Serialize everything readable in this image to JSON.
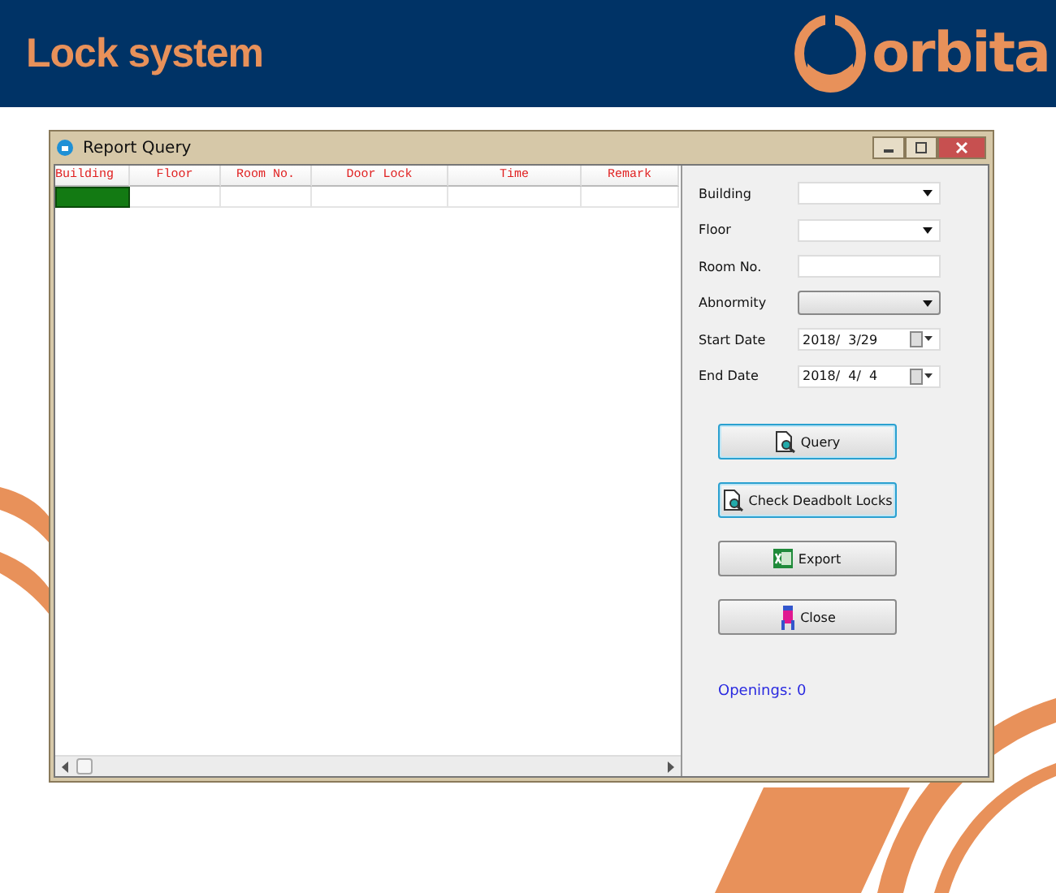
{
  "header": {
    "title": "Lock system",
    "logo_text": "orbita"
  },
  "window": {
    "title": "Report Query"
  },
  "grid": {
    "columns": [
      "Building",
      "Floor",
      "Room No.",
      "Door Lock",
      "Time",
      "Remark"
    ],
    "rows": [
      {
        "focused": true
      }
    ]
  },
  "form": {
    "fields": [
      {
        "label": "Building",
        "kind": "select"
      },
      {
        "label": "Floor",
        "kind": "select"
      },
      {
        "label": "Room No.",
        "kind": "input"
      },
      {
        "label": "Abnormity",
        "kind": "combo"
      },
      {
        "label": "Start Date",
        "kind": "date",
        "value": "2018/  3/29"
      },
      {
        "label": "End Date",
        "kind": "date",
        "value": "2018/  4/  4"
      }
    ],
    "buttons": [
      {
        "label": "Query",
        "kind": "search",
        "highlighted": true
      },
      {
        "label": "Check Deadbolt Locks",
        "kind": "search",
        "highlighted": true
      },
      {
        "label": "Export",
        "kind": "export",
        "highlighted": false
      },
      {
        "label": "Close",
        "kind": "close",
        "highlighted": false
      }
    ],
    "status": "Openings: 0"
  }
}
